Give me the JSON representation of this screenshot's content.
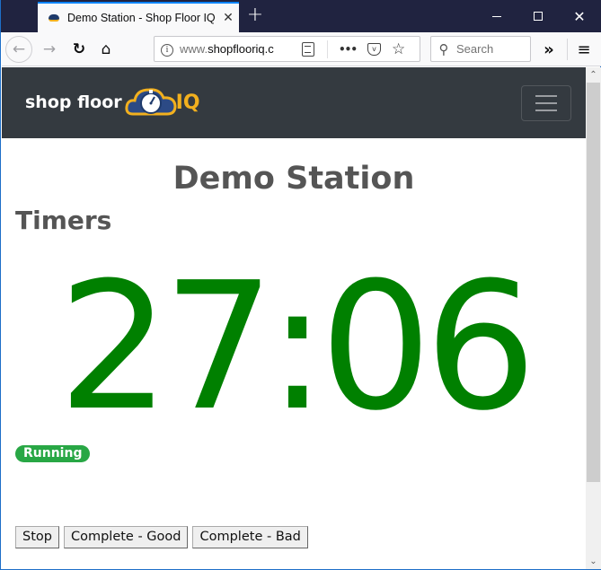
{
  "browser": {
    "tab_title": "Demo Station - Shop Floor IQ",
    "tab_close": "✕",
    "new_tab": "+",
    "url_prefix": "www.",
    "url_domain": "shopflooriq.c",
    "search_placeholder": "Search",
    "icons": {
      "back": "←",
      "forward": "→",
      "reload": "↻",
      "home": "⌂",
      "info": "i",
      "more": "•••",
      "pocket": "v",
      "star": "☆",
      "search": "⚲",
      "overflow": "»",
      "menu": "≡",
      "close_window": "✕",
      "scroll_up": "⌃",
      "scroll_down": "⌄"
    }
  },
  "site": {
    "logo_text": "shop floor",
    "logo_iq": "IQ",
    "brand_color": "#f2b01e",
    "nav_bg": "#343a40"
  },
  "main": {
    "page_title": "Demo Station",
    "section_title": "Timers",
    "timer_value": "27:06",
    "timer_color": "#008000",
    "status_badge": "Running",
    "status_color": "#28a745",
    "buttons": {
      "stop": "Stop",
      "complete_good": "Complete - Good",
      "complete_bad": "Complete - Bad"
    }
  }
}
